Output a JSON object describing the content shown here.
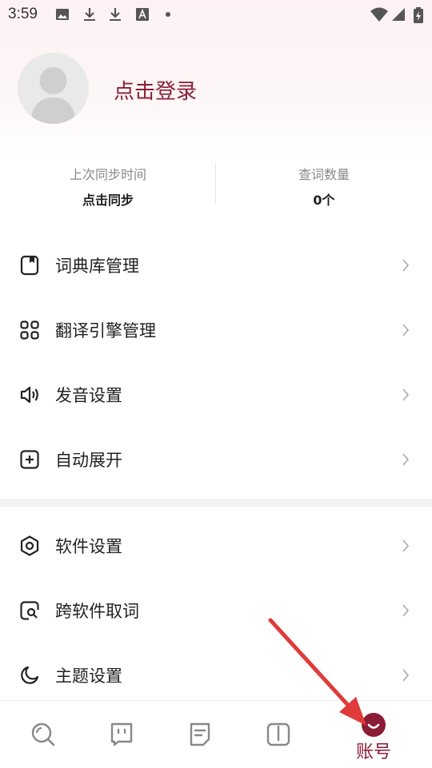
{
  "status_bar": {
    "time": "3:59",
    "icons_left": [
      "image-icon",
      "download-icon",
      "download-icon",
      "font-icon",
      "dot-icon"
    ],
    "icons_right": [
      "wifi-icon",
      "signal-icon",
      "battery-charging-icon"
    ]
  },
  "profile": {
    "login_text": "点击登录"
  },
  "stats": {
    "last_sync_label": "上次同步时间",
    "last_sync_value": "点击同步",
    "word_count_label": "查词数量",
    "word_count_value": "0个"
  },
  "menu": {
    "group1": [
      {
        "label": "词典库管理",
        "icon": "book-outline-icon"
      },
      {
        "label": "翻译引擎管理",
        "icon": "grid-icon"
      },
      {
        "label": "发音设置",
        "icon": "speaker-icon"
      },
      {
        "label": "自动展开",
        "icon": "plus-square-icon"
      }
    ],
    "group2": [
      {
        "label": "软件设置",
        "icon": "hexagon-settings-icon"
      },
      {
        "label": "跨软件取词",
        "icon": "search-square-icon"
      },
      {
        "label": "主题设置",
        "icon": "moon-icon"
      }
    ]
  },
  "bottom_nav": {
    "items": [
      {
        "name": "search",
        "icon": "search-icon"
      },
      {
        "name": "chat",
        "icon": "chat-face-icon"
      },
      {
        "name": "notes",
        "icon": "note-icon"
      },
      {
        "name": "book",
        "icon": "open-book-icon"
      },
      {
        "name": "account",
        "icon": "smile-circle-icon",
        "label": "账号",
        "active": true
      }
    ]
  },
  "colors": {
    "accent": "#8b1c35",
    "annotation_arrow": "#e03a3a"
  }
}
